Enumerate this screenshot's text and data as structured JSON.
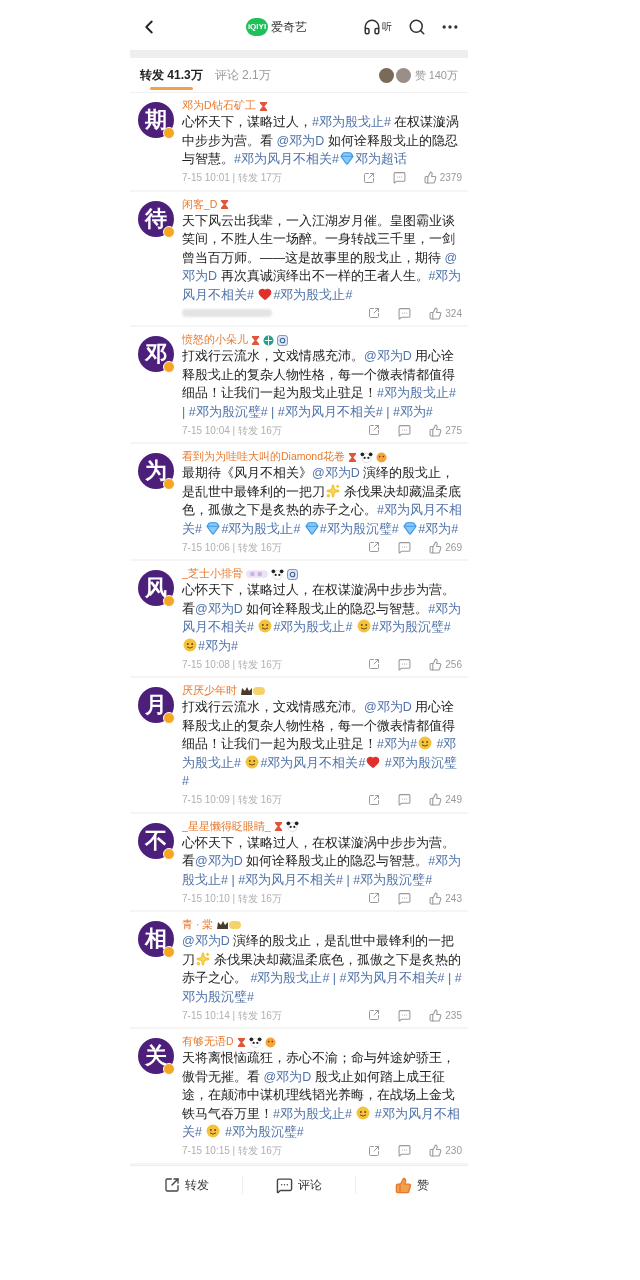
{
  "header": {
    "logo_text": "iQIYI",
    "title": "爱奇艺",
    "listen_label": "听"
  },
  "tabs": [
    {
      "label": "转发 41.3万",
      "selected": true
    },
    {
      "label": "评论 2.1万",
      "selected": false
    }
  ],
  "likes_label": "赞 140万",
  "posts": [
    {
      "avatar": "期",
      "name": "邓为D钻石矿工",
      "badges": [
        {
          "kind": "hourglass"
        }
      ],
      "content": [
        {
          "kind": "text",
          "text": "心怀天下，谋略过人，"
        },
        {
          "kind": "link",
          "text": "#邓为殷戈止#"
        },
        {
          "kind": "text",
          "text": " 在权谋漩涡中步步为营。看 "
        },
        {
          "kind": "link",
          "text": "@邓为D"
        },
        {
          "kind": "text",
          "text": " 如何诠释殷戈止的隐忍与智慧。"
        },
        {
          "kind": "link",
          "text": "#邓为风月不相关#"
        },
        {
          "kind": "diamond"
        },
        {
          "kind": "link",
          "text": "邓为超话"
        }
      ],
      "meta": "7-15 10:01 | 转发 17万",
      "likes": "2379"
    },
    {
      "avatar": "待",
      "name": "闲客_D",
      "badges": [
        {
          "kind": "hourglass"
        }
      ],
      "content": [
        {
          "kind": "text",
          "text": "天下风云出我辈，一入江湖岁月催。皇图霸业谈笑间，不胜人生一场醉。一身转战三千里，一剑曾当百万师。——这是故事里的殷戈止，期待 "
        },
        {
          "kind": "link",
          "text": "@邓为D"
        },
        {
          "kind": "text",
          "text": " 再次真诚演绎出不一样的王者人生。"
        },
        {
          "kind": "link",
          "text": "#邓为风月不相关# "
        },
        {
          "kind": "heart"
        },
        {
          "kind": "link",
          "text": "#邓为殷戈止#"
        }
      ],
      "likes": "324"
    },
    {
      "avatar": "邓",
      "name": "愤怒的小朵儿",
      "badges": [
        {
          "kind": "hourglass"
        },
        {
          "kind": "globe"
        },
        {
          "kind": "ring"
        }
      ],
      "content": [
        {
          "kind": "text",
          "text": "打戏行云流水，文戏情感充沛。"
        },
        {
          "kind": "link",
          "text": "@邓为D"
        },
        {
          "kind": "text",
          "text": " 用心诠释殷戈止的复杂人物性格，每一个微表情都值得细品！让我们一起为殷戈止驻足！"
        },
        {
          "kind": "link",
          "text": "#邓为殷戈止# | #邓为殷沉璧# | #邓为风月不相关# | #邓为#"
        }
      ],
      "meta": "7-15 10:04 | 转发 16万",
      "likes": "275"
    },
    {
      "avatar": "为",
      "name": "看到为为哇哇大叫的Diamond花卷",
      "badges": [
        {
          "kind": "hourglass"
        },
        {
          "kind": "panda"
        },
        {
          "kind": "face"
        }
      ],
      "content": [
        {
          "kind": "text",
          "text": "最期待《风月不相关》"
        },
        {
          "kind": "link",
          "text": "@邓为D"
        },
        {
          "kind": "text",
          "text": " 演绎的殷戈止，是乱世中最锋利的一把刀"
        },
        {
          "kind": "sparkle"
        },
        {
          "kind": "text",
          "text": " 杀伐果决却藏温柔底色，孤傲之下是炙热的赤子之心。"
        },
        {
          "kind": "link",
          "text": "#邓为风月不相关# "
        },
        {
          "kind": "diamond"
        },
        {
          "kind": "link",
          "text": "#邓为殷戈止# "
        },
        {
          "kind": "diamond"
        },
        {
          "kind": "link",
          "text": "#邓为殷沉璧# "
        },
        {
          "kind": "diamond"
        },
        {
          "kind": "link",
          "text": "#邓为#"
        }
      ],
      "meta": "7-15 10:06 | 转发 16万",
      "likes": "269"
    },
    {
      "avatar": "风",
      "name": "_芝士小排骨",
      "badges": [
        {
          "kind": "cloud"
        },
        {
          "kind": "panda"
        },
        {
          "kind": "ring"
        }
      ],
      "content": [
        {
          "kind": "text",
          "text": "心怀天下，谋略过人，在权谋漩涡中步步为营。看"
        },
        {
          "kind": "link",
          "text": "@邓为D"
        },
        {
          "kind": "text",
          "text": " 如何诠释殷戈止的隐忍与智慧。"
        },
        {
          "kind": "link",
          "text": "#邓为风月不相关# "
        },
        {
          "kind": "face"
        },
        {
          "kind": "link",
          "text": "#邓为殷戈止# "
        },
        {
          "kind": "face"
        },
        {
          "kind": "link",
          "text": "#邓为殷沉璧# "
        },
        {
          "kind": "face"
        },
        {
          "kind": "link",
          "text": "#邓为#"
        }
      ],
      "meta": "7-15 10:08 | 转发 16万",
      "likes": "256"
    },
    {
      "avatar": "月",
      "name": "厌厌少年时",
      "badges": [
        {
          "kind": "crown"
        }
      ],
      "content": [
        {
          "kind": "text",
          "text": "打戏行云流水，文戏情感充沛。"
        },
        {
          "kind": "link",
          "text": "@邓为D"
        },
        {
          "kind": "text",
          "text": " 用心诠释殷戈止的复杂人物性格，每一个微表情都值得细品！让我们一起为殷戈止驻足！"
        },
        {
          "kind": "link",
          "text": "#邓为#"
        },
        {
          "kind": "face"
        },
        {
          "kind": "link",
          "text": " #邓为殷戈止# "
        },
        {
          "kind": "face"
        },
        {
          "kind": "link",
          "text": "#邓为风月不相关#"
        },
        {
          "kind": "heart"
        },
        {
          "kind": "link",
          "text": " #邓为殷沉璧#"
        }
      ],
      "meta": "7-15 10:09 | 转发 16万",
      "likes": "249"
    },
    {
      "avatar": "不",
      "name": "_星星懒得眨眼睛_",
      "badges": [
        {
          "kind": "hourglass"
        },
        {
          "kind": "panda"
        }
      ],
      "content": [
        {
          "kind": "text",
          "text": "心怀天下，谋略过人，在权谋漩涡中步步为营。看"
        },
        {
          "kind": "link",
          "text": "@邓为D"
        },
        {
          "kind": "text",
          "text": " 如何诠释殷戈止的隐忍与智慧。"
        },
        {
          "kind": "link",
          "text": "#邓为殷戈止# | #邓为风月不相关# | #邓为殷沉璧#"
        }
      ],
      "meta": "7-15 10:10 | 转发 16万",
      "likes": "243"
    },
    {
      "avatar": "相",
      "name": "青 · 棠",
      "badges": [
        {
          "kind": "crown"
        }
      ],
      "content": [
        {
          "kind": "link",
          "text": "@邓为D"
        },
        {
          "kind": "text",
          "text": " 演绎的殷戈止，是乱世中最锋利的一把刀"
        },
        {
          "kind": "sparkle"
        },
        {
          "kind": "text",
          "text": " 杀伐果决却藏温柔底色，孤傲之下是炙热的赤子之心。 "
        },
        {
          "kind": "link",
          "text": "#邓为殷戈止# | #邓为风月不相关# | #邓为殷沉璧#"
        }
      ],
      "meta": "7-15 10:14 | 转发 16万",
      "likes": "235"
    },
    {
      "avatar": "关",
      "name": "有够无语D",
      "badges": [
        {
          "kind": "hourglass"
        },
        {
          "kind": "panda"
        },
        {
          "kind": "face"
        }
      ],
      "content": [
        {
          "kind": "text",
          "text": "天将离恨恼疏狂，赤心不渝；命与舛途妒骄王，傲骨无摧。看 "
        },
        {
          "kind": "link",
          "text": "@邓为D"
        },
        {
          "kind": "text",
          "text": " 殷戈止如何踏上成王征途，在颠沛中谋机理线韬光养晦，在战场上金戈铁马气吞万里！"
        },
        {
          "kind": "link",
          "text": "#邓为殷戈止# "
        },
        {
          "kind": "face"
        },
        {
          "kind": "link",
          "text": " #邓为风月不相关# "
        },
        {
          "kind": "face"
        },
        {
          "kind": "link",
          "text": " #邓为殷沉璧#"
        }
      ],
      "meta": "7-15 10:15 | 转发 16万",
      "likes": "230"
    }
  ],
  "bottom_bar": [
    {
      "kind": "repost",
      "label": "转发"
    },
    {
      "kind": "comment",
      "label": "评论"
    },
    {
      "kind": "like",
      "label": "赞"
    }
  ]
}
